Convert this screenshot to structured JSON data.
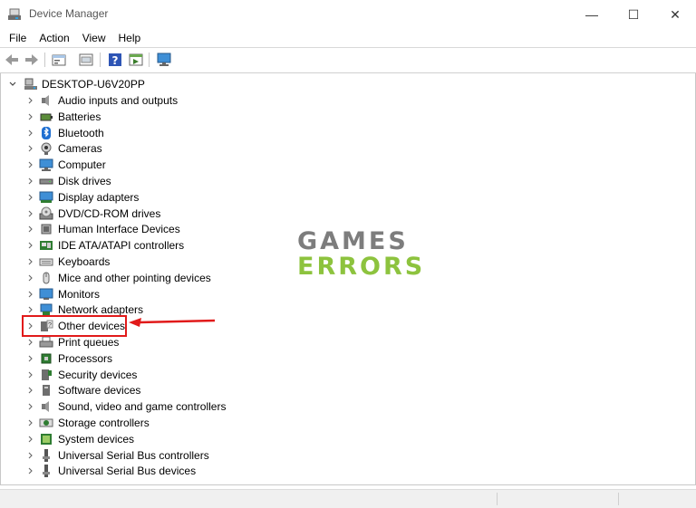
{
  "window": {
    "title": "Device Manager",
    "minimize": "—",
    "maximize": "☐",
    "close": "✕"
  },
  "menu": [
    "File",
    "Action",
    "View",
    "Help"
  ],
  "toolbar": [
    "back-icon",
    "forward-icon",
    "properties-icon",
    "update-driver-icon",
    "help-icon",
    "run-icon",
    "scan-hardware-icon"
  ],
  "tree": {
    "root": "DESKTOP-U6V20PP",
    "items": [
      {
        "label": "Audio inputs and outputs",
        "icon": "speaker-icon"
      },
      {
        "label": "Batteries",
        "icon": "battery-icon"
      },
      {
        "label": "Bluetooth",
        "icon": "bluetooth-icon"
      },
      {
        "label": "Cameras",
        "icon": "camera-icon"
      },
      {
        "label": "Computer",
        "icon": "computer-icon"
      },
      {
        "label": "Disk drives",
        "icon": "disk-drive-icon"
      },
      {
        "label": "Display adapters",
        "icon": "display-adapter-icon"
      },
      {
        "label": "DVD/CD-ROM drives",
        "icon": "dvd-drive-icon"
      },
      {
        "label": "Human Interface Devices",
        "icon": "hid-icon"
      },
      {
        "label": "IDE ATA/ATAPI controllers",
        "icon": "ide-controller-icon"
      },
      {
        "label": "Keyboards",
        "icon": "keyboard-icon"
      },
      {
        "label": "Mice and other pointing devices",
        "icon": "mouse-icon"
      },
      {
        "label": "Monitors",
        "icon": "monitor-icon"
      },
      {
        "label": "Network adapters",
        "icon": "network-adapter-icon"
      },
      {
        "label": "Other devices",
        "icon": "other-devices-icon"
      },
      {
        "label": "Print queues",
        "icon": "printer-icon"
      },
      {
        "label": "Processors",
        "icon": "processor-icon"
      },
      {
        "label": "Security devices",
        "icon": "security-device-icon"
      },
      {
        "label": "Software devices",
        "icon": "software-device-icon"
      },
      {
        "label": "Sound, video and game controllers",
        "icon": "sound-controller-icon"
      },
      {
        "label": "Storage controllers",
        "icon": "storage-controller-icon"
      },
      {
        "label": "System devices",
        "icon": "system-device-icon"
      },
      {
        "label": "Universal Serial Bus controllers",
        "icon": "usb-controller-icon"
      },
      {
        "label": "Universal Serial Bus devices",
        "icon": "usb-device-icon"
      }
    ]
  },
  "watermark": {
    "line1": "GAMES",
    "line2": "ERRORS"
  },
  "colors": {
    "highlight": "#e11a1a",
    "watermark_gray": "#7d7d7d",
    "watermark_green": "#8dc33e"
  }
}
